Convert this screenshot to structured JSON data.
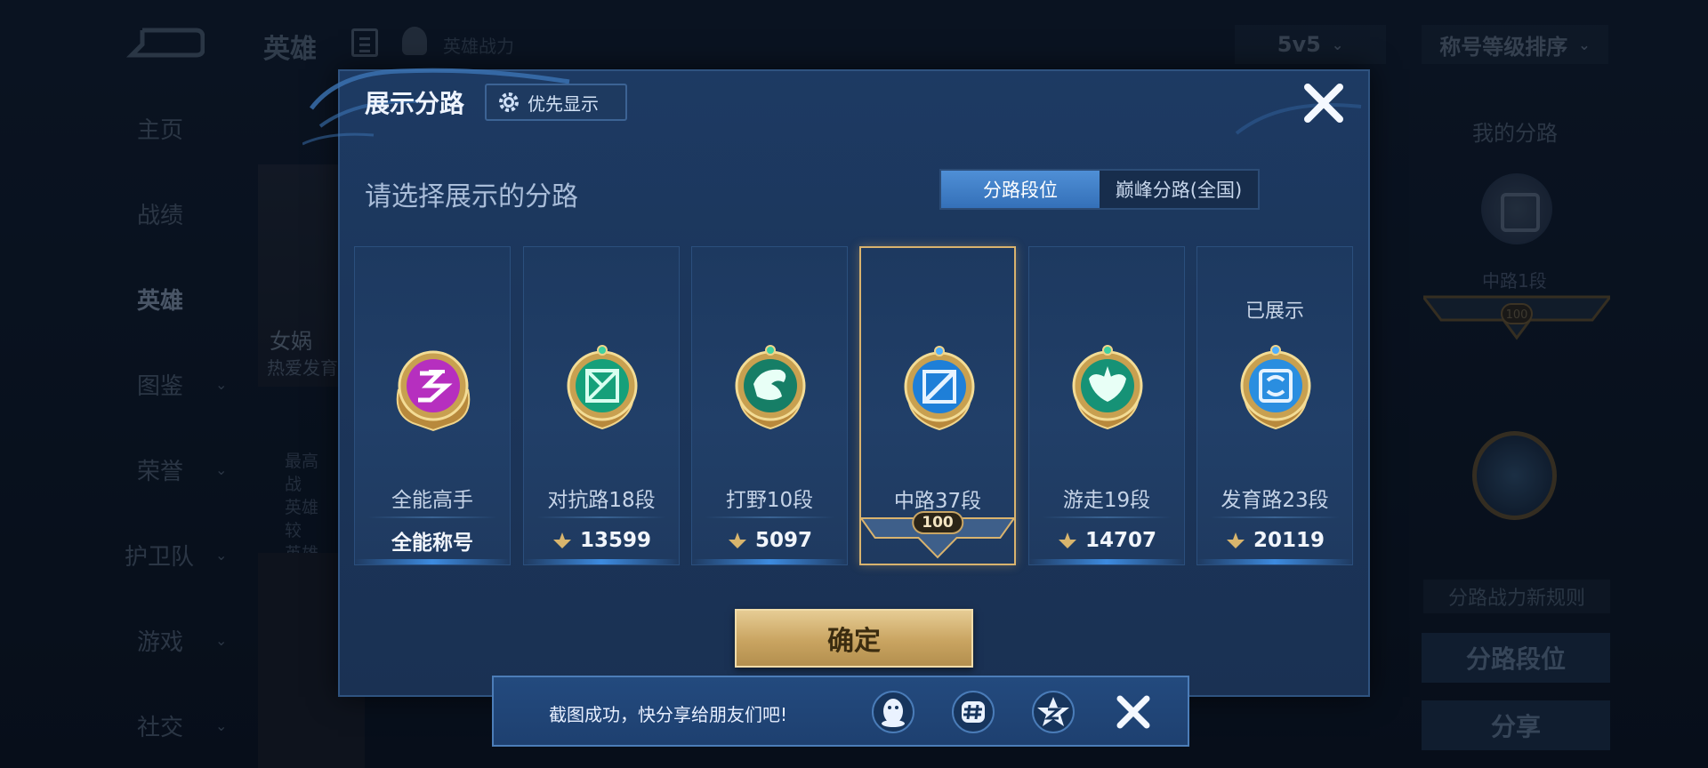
{
  "background": {
    "title": "英雄",
    "subtitle": "英雄战力",
    "mode_select": "5v5",
    "sort_select": "称号等级排序",
    "nav": [
      {
        "label": "主页",
        "has_chevron": false,
        "active": false
      },
      {
        "label": "战绩",
        "has_chevron": false,
        "active": false
      },
      {
        "label": "英雄",
        "has_chevron": false,
        "active": true
      },
      {
        "label": "图鉴",
        "has_chevron": true,
        "active": false
      },
      {
        "label": "荣誉",
        "has_chevron": true,
        "active": false
      },
      {
        "label": "护卫队",
        "has_chevron": true,
        "active": false
      },
      {
        "label": "游戏",
        "has_chevron": true,
        "active": false
      },
      {
        "label": "社交",
        "has_chevron": true,
        "active": false
      }
    ],
    "hero_name": "女娲",
    "hero_desc": "热爱发育",
    "hero_info_lines": [
      "最高战",
      "英雄较",
      "英雄散"
    ],
    "right_title": "我的分路",
    "right_lane": "中路1段",
    "right_badge_num": "100",
    "right_rule": "分路战力新规则",
    "right_btn_primary": "分路段位",
    "right_btn_share": "分享"
  },
  "modal": {
    "title": "展示分路",
    "priority_label": "优先显示",
    "prompt": "请选择展示的分路",
    "tabs": [
      {
        "label": "分路段位",
        "active": true
      },
      {
        "label": "巅峰分路(全国)",
        "active": false
      }
    ],
    "cards": [
      {
        "name": "all-rounder",
        "rank": "全能高手",
        "power": "全能称号",
        "is_title": true,
        "selected": false,
        "shown": "",
        "medal_color": "#c02fc8",
        "icon": "all-rounder-icon"
      },
      {
        "name": "clash-lane",
        "rank": "对抗路18段",
        "power": "13599",
        "is_title": false,
        "selected": false,
        "shown": "",
        "medal_color": "#1aa57a",
        "icon": "clash-lane-icon"
      },
      {
        "name": "jungle",
        "rank": "打野10段",
        "power": "5097",
        "is_title": false,
        "selected": false,
        "shown": "",
        "medal_color": "#1a8a6e",
        "icon": "jungle-dragon-icon"
      },
      {
        "name": "mid-lane",
        "rank": "中路37段",
        "power": "100",
        "is_title": false,
        "selected": true,
        "shown": "",
        "medal_color": "#1e7fd8",
        "icon": "mid-lane-icon"
      },
      {
        "name": "roam",
        "rank": "游走19段",
        "power": "14707",
        "is_title": false,
        "selected": false,
        "shown": "",
        "medal_color": "#1a9a7a",
        "icon": "roam-wings-icon"
      },
      {
        "name": "farm-lane",
        "rank": "发育路23段",
        "power": "20119",
        "is_title": false,
        "selected": false,
        "shown": "已展示",
        "medal_color": "#2a8ee0",
        "icon": "farm-lane-icon"
      }
    ],
    "confirm_label": "确定"
  },
  "toast": {
    "text": "截图成功，快分享给朋友们吧!",
    "icons": [
      "qq-icon",
      "hashtag-icon",
      "qzone-star-icon"
    ]
  },
  "colors": {
    "modal_bg": "#1d3a63",
    "tab_active": "#3f80c8",
    "gold": "#d9b36e",
    "confirm_gold": "#c9a461"
  }
}
